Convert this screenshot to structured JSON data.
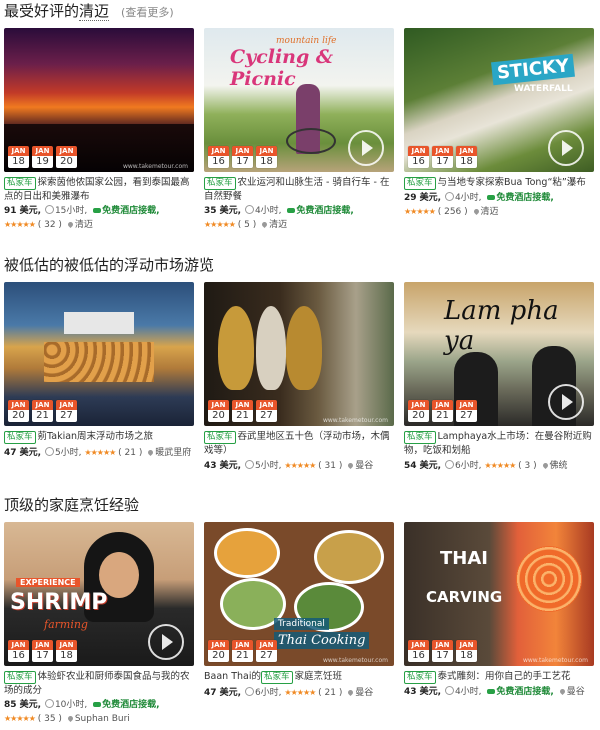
{
  "sections": [
    {
      "title_prefix": "最受好评的",
      "title_highlight": "清迈",
      "more": "(查看更多)",
      "cards": [
        {
          "badge": "私家车",
          "title": "探索茵他侬国家公园，看到泰国最高点的日出和美雅瀑布",
          "price": "91 美元,",
          "duration": "15小时,",
          "transfer": "免费酒店接载,",
          "stars": "★★★★★",
          "reviews": "( 32 )",
          "location": "清迈",
          "month": "JAN",
          "dates": [
            "18",
            "19",
            "20"
          ],
          "has_play": false
        },
        {
          "badge": "私家车",
          "title": "农业运河和山脉生活 - 骑自行车 - 在自然野餐",
          "price": "35 美元,",
          "duration": "4小时,",
          "transfer": "免费酒店接载,",
          "stars": "★★★★★",
          "reviews": "( 5 )",
          "location": "清迈",
          "overlay_top": "mountain life",
          "overlay_main": "Cycling & Picnic",
          "month": "JAN",
          "dates": [
            "16",
            "17",
            "18"
          ],
          "has_play": true
        },
        {
          "badge": "私家车",
          "title": "与当地专家探索Bua Tong“粘”瀑布",
          "price": "29 美元,",
          "duration": "4小时,",
          "transfer": "免费酒店接载,",
          "stars": "★★★★★",
          "reviews": "( 256 )",
          "location": "清迈",
          "overlay_main": "STICKY",
          "overlay_sub": "WATERFALL",
          "month": "JAN",
          "dates": [
            "16",
            "17",
            "18"
          ],
          "has_play": true
        }
      ]
    },
    {
      "title_prefix": "被低估的被低估的浮动市场游览",
      "title_highlight": "",
      "more": "",
      "cards": [
        {
          "badge": "私家车",
          "title": "莂Takian周末浮动市场之旅",
          "price": "47 美元,",
          "duration": "5小时,",
          "transfer": "",
          "stars": "★★★★★",
          "reviews": "( 21 )",
          "location": "暖武里府",
          "month": "JAN",
          "dates": [
            "20",
            "21",
            "27"
          ],
          "has_play": false
        },
        {
          "badge": "私家车",
          "title": "吞武里地区五十色（浮动市场，木偶戏等）",
          "price": "43 美元,",
          "duration": "5小时,",
          "transfer": "",
          "stars": "★★★★★",
          "reviews": "( 31 )",
          "location": "曼谷",
          "month": "JAN",
          "dates": [
            "20",
            "21",
            "27"
          ],
          "has_play": false
        },
        {
          "badge": "私家车",
          "title": "Lamphaya水上市场：在曼谷附近购物，吃饭和划船",
          "price": "54 美元,",
          "duration": "6小时,",
          "transfer": "",
          "stars": "★★★★★",
          "reviews": "( 3 )",
          "location": "佛统",
          "overlay_main": "Lam pha ya",
          "month": "JAN",
          "dates": [
            "20",
            "21",
            "27"
          ],
          "has_play": true
        }
      ]
    },
    {
      "title_prefix": "顶级的家庭烹饪经验",
      "title_highlight": "",
      "more": "",
      "cards": [
        {
          "badge": "私家车",
          "title": "体验虾农业和厨师泰国食品与我的农场的成分",
          "price": "85 美元,",
          "duration": "10小时,",
          "transfer": "免费酒店接载,",
          "stars": "★★★★★",
          "reviews": "( 35 )",
          "location": "Suphan Buri",
          "overlay_top": "EXPERIENCE",
          "overlay_main": "SHRIMP",
          "overlay_sub": "farming",
          "month": "JAN",
          "dates": [
            "16",
            "17",
            "18"
          ],
          "has_play": true
        },
        {
          "badge": "私家车",
          "title_before": "Baan Thai的",
          "title": "家庭烹饪班",
          "price": "47 美元,",
          "duration": "6小时,",
          "transfer": "",
          "stars": "★★★★★",
          "reviews": "( 21 )",
          "location": "曼谷",
          "overlay_top": "Traditional",
          "overlay_main": "Thai Cooking",
          "month": "JAN",
          "dates": [
            "20",
            "21",
            "27"
          ],
          "has_play": false
        },
        {
          "badge": "私家车",
          "title": "泰式雕刻：用你自己的手工艺花",
          "price": "43 美元,",
          "duration": "4小时,",
          "transfer": "免费酒店接载,",
          "stars": "",
          "reviews": "",
          "location": "曼谷",
          "overlay_main": "THAI",
          "overlay_sub": "CARVING",
          "month": "JAN",
          "dates": [
            "16",
            "17",
            "18"
          ],
          "has_play": false
        }
      ]
    }
  ],
  "watermark": "www.takemetour.com",
  "colors": {
    "accent": "#e8552b",
    "badge_green": "#27a045",
    "star": "#f08a24"
  }
}
